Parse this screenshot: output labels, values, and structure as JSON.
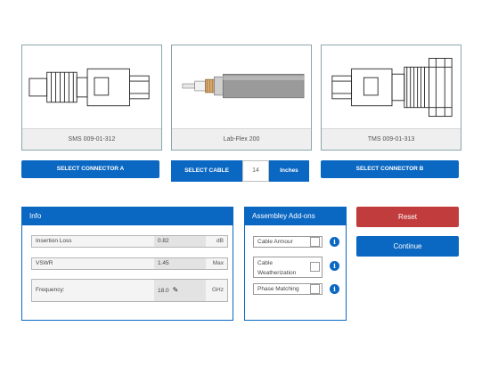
{
  "connectors": {
    "a": {
      "caption": "SMS 009-01-312",
      "button": "SELECT CONNECTOR A"
    },
    "cable": {
      "caption": "Lab-Flex 200"
    },
    "b": {
      "caption": "TMS 009-01-313",
      "button": "SELECT CONNECTOR B"
    }
  },
  "cable_select": {
    "button": "SELECT CABLE",
    "length": "14",
    "unit": "Inches"
  },
  "info": {
    "title": "Info",
    "rows": [
      {
        "label": "Insertion Loss",
        "value": "0.82",
        "unit": "dB"
      },
      {
        "label": "VSWR",
        "value": "1.45",
        "unit": "Max"
      },
      {
        "label": "Frequency:",
        "value": "18.0",
        "unit": "GHz"
      }
    ]
  },
  "addons": {
    "title": "Assembley Add-ons",
    "items": [
      {
        "label": "Cable Armour"
      },
      {
        "label_line1": "Cable",
        "label_line2": "Weatherization"
      },
      {
        "label": "Phase Matching"
      }
    ]
  },
  "actions": {
    "reset": "Reset",
    "continue": "Continue"
  },
  "colors": {
    "primary": "#0a67c2",
    "danger": "#c13c3c",
    "card_border": "#8aa6ad"
  },
  "icons": [
    "connector-a-drawing",
    "cable-drawing",
    "connector-b-drawing",
    "edit-icon",
    "info-icon"
  ]
}
